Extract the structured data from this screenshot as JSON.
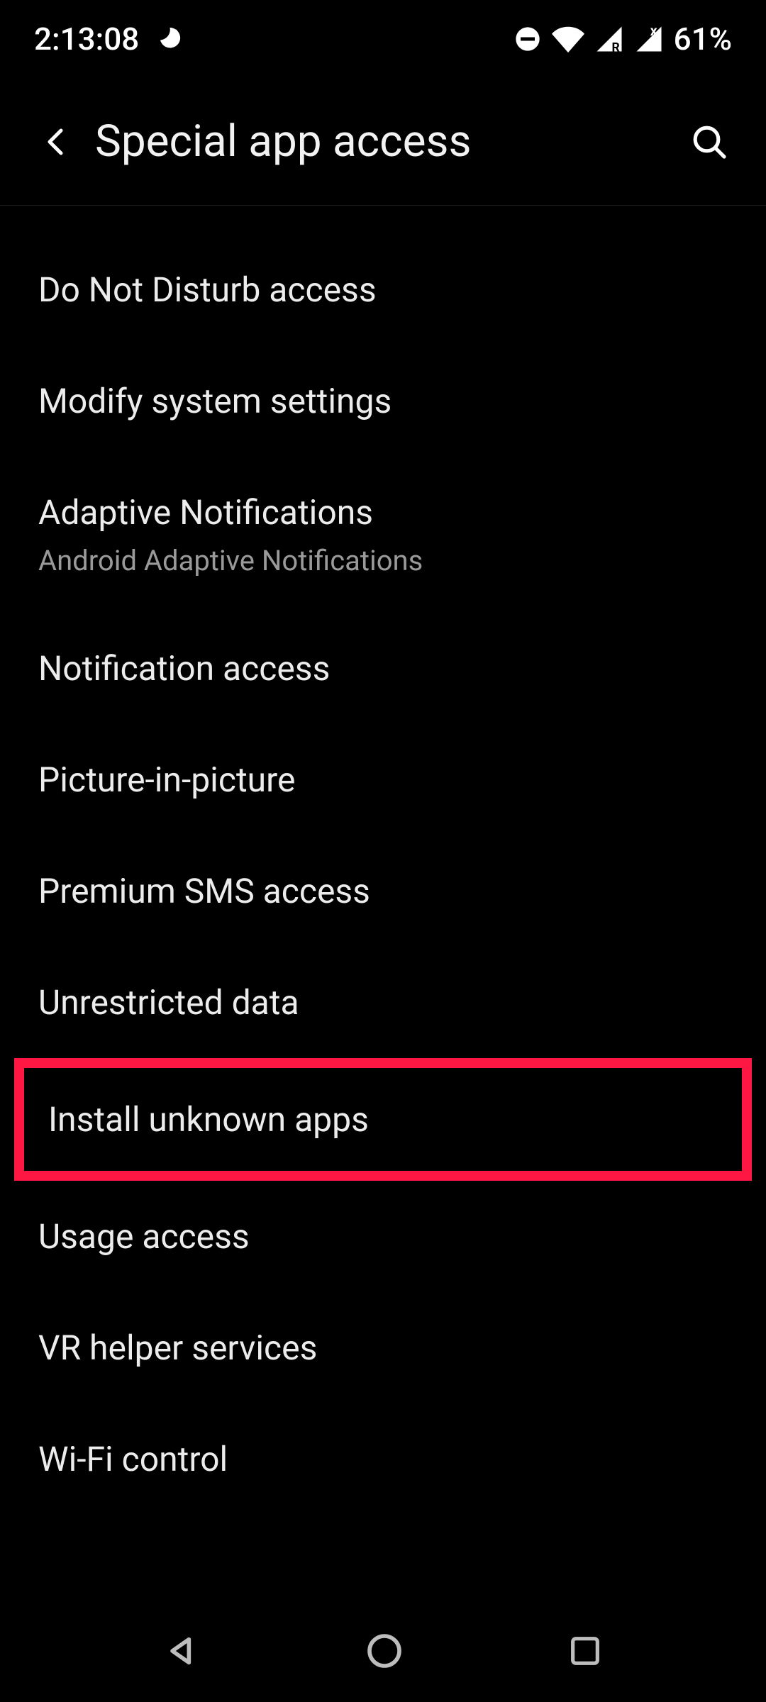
{
  "status": {
    "time": "2:13:08",
    "battery": "61%"
  },
  "header": {
    "title": "Special app access"
  },
  "items": [
    {
      "title": "Do Not Disturb access"
    },
    {
      "title": "Modify system settings"
    },
    {
      "title": "Adaptive Notifications",
      "subtitle": "Android Adaptive Notifications"
    },
    {
      "title": "Notification access"
    },
    {
      "title": "Picture-in-picture"
    },
    {
      "title": "Premium SMS access"
    },
    {
      "title": "Unrestricted data"
    },
    {
      "title": "Install unknown apps",
      "highlighted": true
    },
    {
      "title": "Usage access"
    },
    {
      "title": "VR helper services"
    },
    {
      "title": "Wi-Fi control"
    }
  ]
}
